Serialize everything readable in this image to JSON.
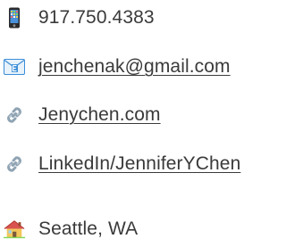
{
  "contacts": [
    {
      "icon": "mobile-phone-icon",
      "text": "917.750.4383",
      "link": false
    },
    {
      "icon": "email-envelope-icon",
      "text": "jenchenak@gmail.com",
      "link": true
    },
    {
      "icon": "link-chain-icon",
      "text": "Jenychen.com",
      "link": true
    },
    {
      "icon": "link-chain-icon",
      "text": "LinkedIn/JenniferYChen",
      "link": true
    },
    {
      "icon": "house-icon",
      "text": "Seattle, WA",
      "link": false
    }
  ],
  "colors": {
    "text": "#3a3a3a",
    "phone": "#2b2b2b",
    "envelope": "#3b8ed8",
    "chain": "#8fa3b3",
    "house_roof": "#d9534f",
    "house_body": "#f3c75b"
  }
}
